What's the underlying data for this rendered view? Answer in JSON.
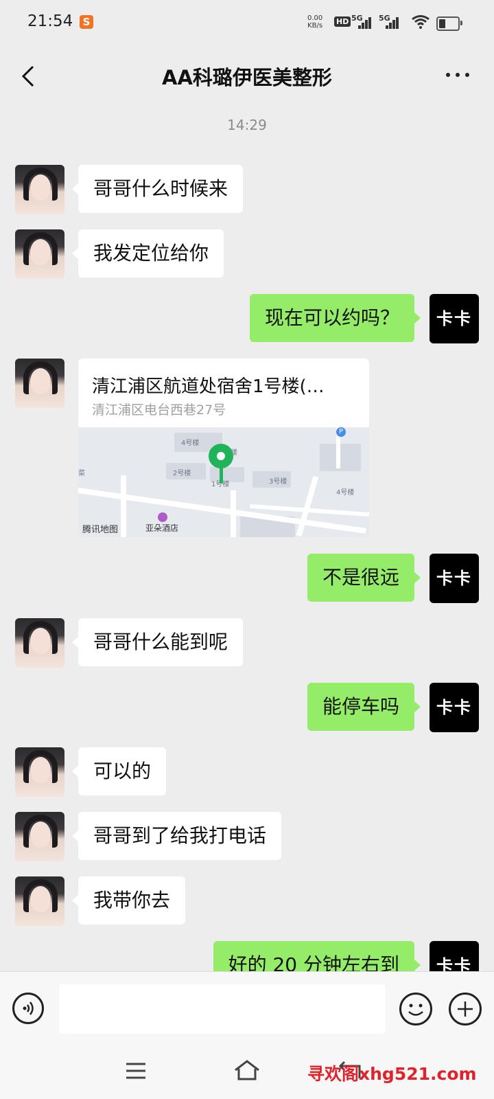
{
  "status_bar": {
    "time": "21:54",
    "net_speed_value": "0.00",
    "net_speed_unit": "KB/s",
    "hd_label": "HD",
    "signal1": "5G",
    "signal2": "5G"
  },
  "header": {
    "title": "AA科璐伊医美整形"
  },
  "timestamp": "14:29",
  "my_avatar_text": "卡卡",
  "messages": [
    {
      "side": "in",
      "text": "哥哥什么时候来"
    },
    {
      "side": "in",
      "text": "我发定位给你"
    },
    {
      "side": "out",
      "text": "现在可以约吗？"
    },
    {
      "side": "in",
      "type": "location"
    },
    {
      "side": "out",
      "text": "不是很远"
    },
    {
      "side": "in",
      "text": "哥哥什么能到呢"
    },
    {
      "side": "out",
      "text": "能停车吗"
    },
    {
      "side": "in",
      "text": "可以的"
    },
    {
      "side": "in",
      "text": "哥哥到了给我打电话"
    },
    {
      "side": "in",
      "text": "我带你去"
    },
    {
      "side": "out",
      "text": "好的 20 分钟左右到"
    }
  ],
  "location": {
    "title": "清江浦区航道处宿舍1号楼(…",
    "address": "清江浦区电台西巷27号",
    "map_brand": "腾讯地图",
    "hotel": "亚朵酒店",
    "labels": [
      "4号楼",
      "楼",
      "2号楼",
      "1号楼",
      "3号楼",
      "4号楼",
      "菜"
    ],
    "parking": "P"
  },
  "watermark": "寻欢阁xhg521.com",
  "colors": {
    "incoming_bubble": "#ffffff",
    "outgoing_bubble": "#95ec69",
    "background": "#ededed",
    "pin": "#1fb45a",
    "watermark": "#e0232a"
  }
}
